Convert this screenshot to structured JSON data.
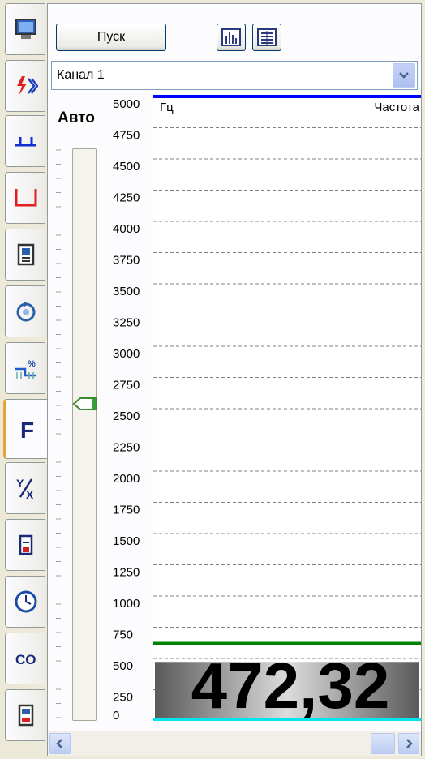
{
  "toolbar": {
    "start_label": "Пуск",
    "chart_view_icon": "bar-chart-icon",
    "table_view_icon": "table-view-icon"
  },
  "channel": {
    "selected": "Канал 1"
  },
  "mode": {
    "auto_label": "Авто"
  },
  "slider": {
    "level_fraction": 0.44
  },
  "tabs": [
    {
      "icon": "monitor-icon"
    },
    {
      "icon": "voltage-arrows-icon"
    },
    {
      "icon": "pulse-blue-icon"
    },
    {
      "icon": "pulse-red-icon"
    },
    {
      "icon": "memory-card-icon"
    },
    {
      "icon": "rotation-icon"
    },
    {
      "icon": "percent-scale-icon"
    },
    {
      "icon": "frequency-icon",
      "label": "F",
      "active": true
    },
    {
      "icon": "ratio-icon",
      "label": "Y/X"
    },
    {
      "icon": "battery-icon"
    },
    {
      "icon": "clock-icon"
    },
    {
      "icon": "co-icon",
      "label": "CO"
    },
    {
      "icon": "device-icon"
    }
  ],
  "chart_data": {
    "type": "bar",
    "unit_label": "Гц",
    "series_label": "Частота",
    "ylim": [
      0,
      5000
    ],
    "ticks": [
      "5000",
      "4750",
      "4500",
      "4250",
      "4000",
      "3750",
      "3500",
      "3250",
      "3000",
      "2750",
      "2500",
      "2250",
      "2000",
      "1750",
      "1500",
      "1250",
      "1000",
      "750",
      "500",
      "250",
      "0"
    ],
    "value": 472.32,
    "value_text": "472,32",
    "marker_value": 620,
    "grid": true,
    "colors": {
      "top_line": "#0000ff",
      "marker_line": "#008000",
      "bottom_line": "#00e5ee",
      "grid": "#808080"
    }
  }
}
